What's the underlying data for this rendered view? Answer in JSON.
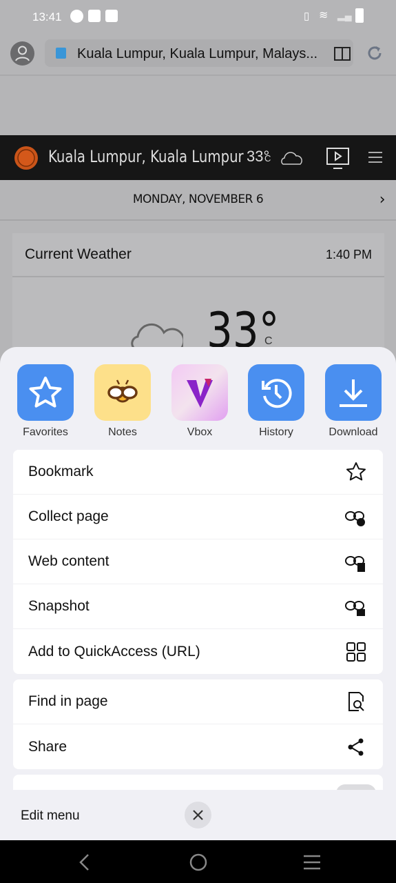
{
  "status": {
    "time": "13:41"
  },
  "browser": {
    "url": "Kuala Lumpur, Kuala Lumpur, Malays..."
  },
  "weather_header": {
    "location": "Kuala Lumpur, Kuala Lumpur",
    "temp": "33°",
    "unit": "C"
  },
  "date_bar": {
    "date": "MONDAY, NOVEMBER 6"
  },
  "current_weather": {
    "title": "Current Weather",
    "time": "1:40 PM",
    "temp": "33°",
    "unit": "C"
  },
  "quick_access": [
    {
      "label": "Favorites",
      "icon": "star-icon",
      "color": "#4a8ff0"
    },
    {
      "label": "Notes",
      "icon": "bee-icon",
      "color": "#fde08a"
    },
    {
      "label": "Vbox",
      "icon": "vbox-icon",
      "color": "#ecc6f2"
    },
    {
      "label": "History",
      "icon": "history-icon",
      "color": "#4a8ff0"
    },
    {
      "label": "Download",
      "icon": "download-icon",
      "color": "#4a8ff0"
    }
  ],
  "menu_group1": [
    {
      "label": "Bookmark",
      "icon": "star-outline-icon"
    },
    {
      "label": "Collect page",
      "icon": "collect-globe-icon"
    },
    {
      "label": "Web content",
      "icon": "collect-doc-icon"
    },
    {
      "label": "Snapshot",
      "icon": "collect-image-icon"
    },
    {
      "label": "Add to QuickAccess (URL)",
      "icon": "grid-icon"
    }
  ],
  "menu_group2": [
    {
      "label": "Find in page",
      "icon": "find-doc-icon"
    },
    {
      "label": "Share",
      "icon": "share-icon"
    }
  ],
  "footer": {
    "edit_label": "Edit menu"
  }
}
